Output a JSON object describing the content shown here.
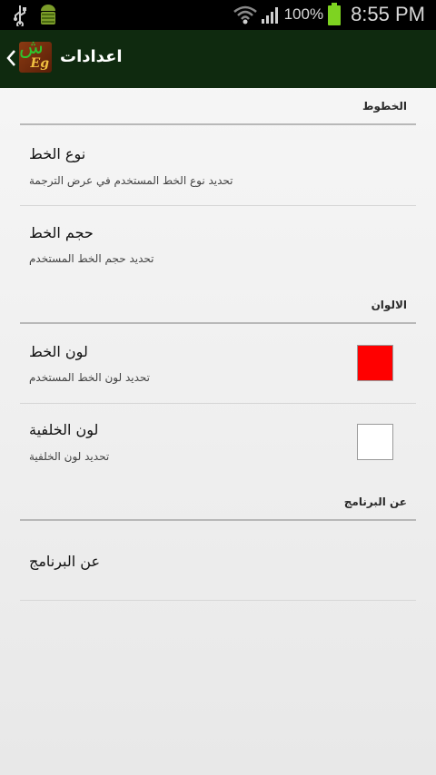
{
  "status_bar": {
    "battery_percent": "100%",
    "time": "8:55 PM",
    "icons": [
      "usb-icon",
      "android-debug-icon",
      "wifi-icon",
      "signal-icon",
      "battery-icon"
    ]
  },
  "action_bar": {
    "title": "اعدادات",
    "app_icon_text": "ش",
    "app_icon_badge": "Eg",
    "background": "#0f2a0f"
  },
  "sections": {
    "fonts": {
      "header": "الخطوط",
      "items": [
        {
          "title": "نوع الخط",
          "summary": "تحديد نوع الخط المستخدم في عرض الترجمة"
        },
        {
          "title": "حجم الخط",
          "summary": "تحديد حجم الخط المستخدم"
        }
      ]
    },
    "colors": {
      "header": "الالوان",
      "items": [
        {
          "title": "لون الخط",
          "summary": "تحديد لون الخط المستخدم",
          "color": "#ff0000"
        },
        {
          "title": "لون الخلفية",
          "summary": "تحديد لون الخلفية",
          "color": "#ffffff"
        }
      ]
    },
    "about": {
      "header": "عن البرنامج",
      "items": [
        {
          "title": "عن البرنامج"
        }
      ]
    }
  }
}
